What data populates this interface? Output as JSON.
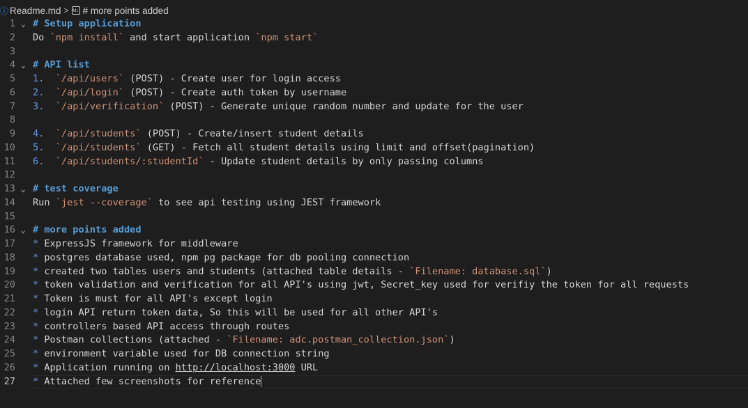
{
  "breadcrumb": {
    "file": "Readme.md",
    "separator": ">",
    "icon_text": "M↓",
    "section": "# more points added"
  },
  "colors": {
    "background": "#1e1e1e",
    "heading": "#569cd6",
    "inline_code": "#ce9178",
    "list_marker": "#6796e6",
    "line_number": "#858585"
  },
  "lines": [
    {
      "n": "1",
      "fold": "⌄",
      "segs": [
        {
          "t": "# Setup application",
          "c": "h"
        }
      ]
    },
    {
      "n": "2",
      "segs": [
        {
          "t": "Do "
        },
        {
          "t": "`npm install`",
          "c": "bt"
        },
        {
          "t": " and start application "
        },
        {
          "t": "`npm start`",
          "c": "bt"
        }
      ]
    },
    {
      "n": "3",
      "segs": []
    },
    {
      "n": "4",
      "fold": "⌄",
      "segs": [
        {
          "t": "# API list",
          "c": "h"
        }
      ]
    },
    {
      "n": "5",
      "segs": [
        {
          "t": "1.",
          "c": "num"
        },
        {
          "t": "  "
        },
        {
          "t": "`/api/users`",
          "c": "bt"
        },
        {
          "t": " (POST) - Create user for login access"
        }
      ]
    },
    {
      "n": "6",
      "segs": [
        {
          "t": "2.",
          "c": "num"
        },
        {
          "t": "  "
        },
        {
          "t": "`/api/login`",
          "c": "bt"
        },
        {
          "t": " (POST) - Create auth token by username"
        }
      ]
    },
    {
      "n": "7",
      "segs": [
        {
          "t": "3.",
          "c": "num"
        },
        {
          "t": "  "
        },
        {
          "t": "`/api/verification`",
          "c": "bt"
        },
        {
          "t": " (POST) - Generate unique random number and update for the user"
        }
      ]
    },
    {
      "n": "8",
      "segs": []
    },
    {
      "n": "9",
      "segs": [
        {
          "t": "4.",
          "c": "num"
        },
        {
          "t": "  "
        },
        {
          "t": "`/api/students`",
          "c": "bt"
        },
        {
          "t": " (POST) - Create/insert student details"
        }
      ]
    },
    {
      "n": "10",
      "segs": [
        {
          "t": "5.",
          "c": "num"
        },
        {
          "t": "  "
        },
        {
          "t": "`/api/students`",
          "c": "bt"
        },
        {
          "t": " (GET) - Fetch all student details using limit and offset(pagination)"
        }
      ]
    },
    {
      "n": "11",
      "segs": [
        {
          "t": "6.",
          "c": "num"
        },
        {
          "t": "  "
        },
        {
          "t": "`/api/students/:studentId`",
          "c": "bt"
        },
        {
          "t": " - Update student details by only passing columns"
        }
      ]
    },
    {
      "n": "12",
      "segs": []
    },
    {
      "n": "13",
      "fold": "⌄",
      "segs": [
        {
          "t": "# test coverage",
          "c": "h"
        }
      ]
    },
    {
      "n": "14",
      "segs": [
        {
          "t": "Run "
        },
        {
          "t": "`jest --coverage`",
          "c": "bt"
        },
        {
          "t": " to see api testing using JEST framework"
        }
      ]
    },
    {
      "n": "15",
      "segs": []
    },
    {
      "n": "16",
      "fold": "⌄",
      "segs": [
        {
          "t": "# more points added",
          "c": "h"
        }
      ]
    },
    {
      "n": "17",
      "segs": [
        {
          "t": "*",
          "c": "bul"
        },
        {
          "t": " ExpressJS framework for middleware"
        }
      ]
    },
    {
      "n": "18",
      "segs": [
        {
          "t": "*",
          "c": "bul"
        },
        {
          "t": " postgres database used, npm pg package for db pooling connection"
        }
      ]
    },
    {
      "n": "19",
      "segs": [
        {
          "t": "*",
          "c": "bul"
        },
        {
          "t": " created two tables users and students (attached table details - "
        },
        {
          "t": "`Filename: database.sql`",
          "c": "bt"
        },
        {
          "t": ")"
        }
      ]
    },
    {
      "n": "20",
      "segs": [
        {
          "t": "*",
          "c": "bul"
        },
        {
          "t": " token validation and verification for all API's using jwt, Secret_key used for verifiy the token for all requests"
        }
      ]
    },
    {
      "n": "21",
      "segs": [
        {
          "t": "*",
          "c": "bul"
        },
        {
          "t": " Token is must for all API's except login"
        }
      ]
    },
    {
      "n": "22",
      "segs": [
        {
          "t": "*",
          "c": "bul"
        },
        {
          "t": " login API return token data, So this will be used for all other API's"
        }
      ]
    },
    {
      "n": "23",
      "segs": [
        {
          "t": "*",
          "c": "bul"
        },
        {
          "t": " controllers based API access through routes"
        }
      ]
    },
    {
      "n": "24",
      "segs": [
        {
          "t": "*",
          "c": "bul"
        },
        {
          "t": " Postman collections (attached - "
        },
        {
          "t": "`Filename: adc.postman_collection.json`",
          "c": "bt"
        },
        {
          "t": ")"
        }
      ]
    },
    {
      "n": "25",
      "segs": [
        {
          "t": "*",
          "c": "bul"
        },
        {
          "t": " environment variable used for DB connection string"
        }
      ]
    },
    {
      "n": "26",
      "segs": [
        {
          "t": "*",
          "c": "bul"
        },
        {
          "t": " Application running on "
        },
        {
          "t": "http://localhost:3000",
          "c": "url"
        },
        {
          "t": " URL"
        }
      ]
    },
    {
      "n": "27",
      "active": true,
      "segs": [
        {
          "t": "*",
          "c": "bul"
        },
        {
          "t": " Attached few screenshots for reference"
        }
      ]
    }
  ]
}
